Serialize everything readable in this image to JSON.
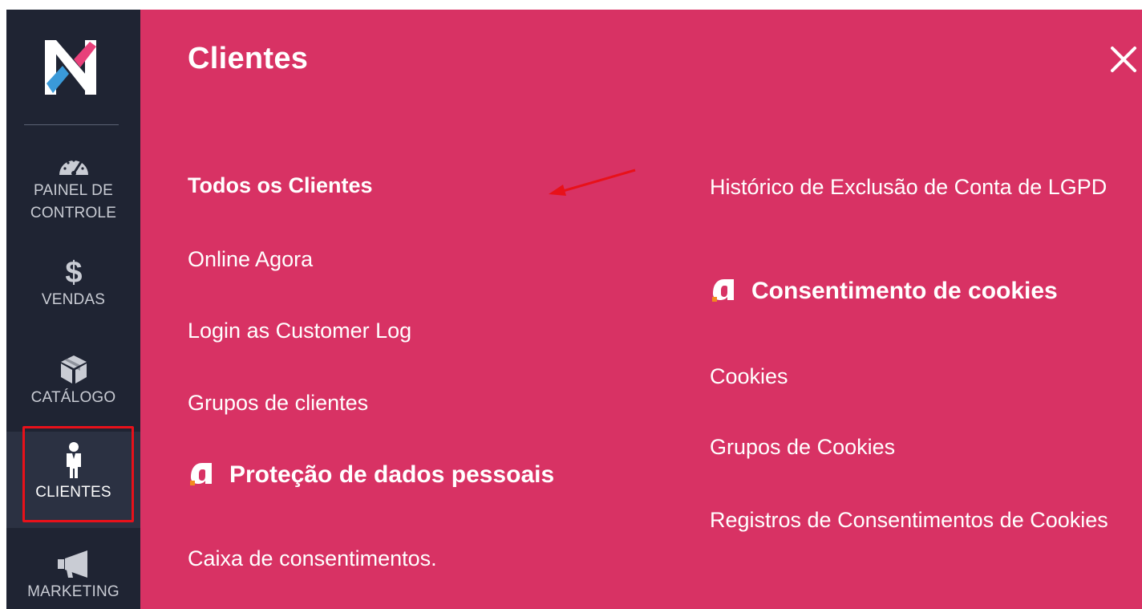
{
  "sidebar": {
    "logo_icon": "n-logo-icon",
    "items": [
      {
        "label": "PAINEL DE\nCONTROLE",
        "icon": "speedometer-icon"
      },
      {
        "label": "VENDAS",
        "icon": "dollar-icon"
      },
      {
        "label": "CATÁLOGO",
        "icon": "box-icon"
      },
      {
        "label": "CLIENTES",
        "icon": "person-icon"
      },
      {
        "label": "MARKETING",
        "icon": "megaphone-icon"
      }
    ],
    "active_item": "CLIENTES",
    "highlight_color": "#e8111a"
  },
  "panel": {
    "title": "Clientes",
    "close_icon": "close-icon",
    "background": "#d83264",
    "left_column": {
      "links": [
        "Todos os Clientes",
        "Online Agora",
        "Login as Customer Log",
        "Grupos de clientes"
      ],
      "section": "Proteção de dados pessoais",
      "section_links": [
        "Caixa de consentimentos."
      ]
    },
    "right_column": {
      "links": [
        "Histórico de Exclusão de Conta de LGPD"
      ],
      "section": "Consentimento de cookies",
      "section_links": [
        "Cookies",
        "Grupos de Cookies",
        "Registros de Consentimentos de Cookies"
      ]
    }
  }
}
